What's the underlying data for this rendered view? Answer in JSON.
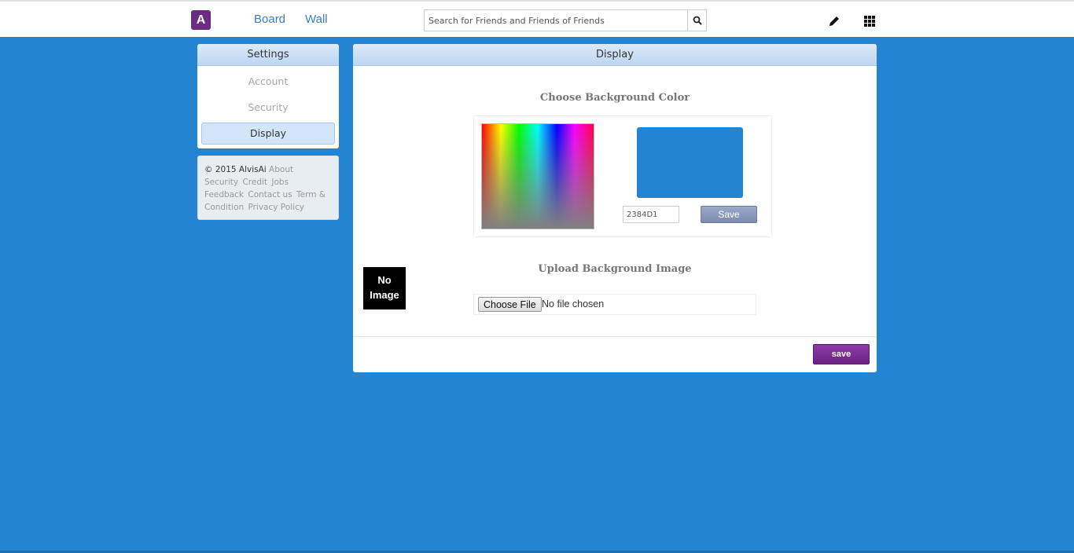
{
  "header": {
    "logo_letter": "A",
    "nav": [
      {
        "label": "Board"
      },
      {
        "label": "Wall"
      }
    ],
    "search": {
      "placeholder": "Search for Friends and Friends of Friends",
      "value": ""
    },
    "icons": [
      "search-icon",
      "pencil-icon",
      "apps-grid-icon"
    ]
  },
  "sidebar": {
    "title": "Settings",
    "items": [
      {
        "label": "Account",
        "active": false
      },
      {
        "label": "Security",
        "active": false
      },
      {
        "label": "Display",
        "active": true
      }
    ]
  },
  "footer": {
    "copyright": "© 2015 AlvisAi",
    "links": [
      "About",
      "Security",
      "Credit",
      "Jobs",
      "Feedback",
      "Contact us",
      "Term & Condition",
      "Privacy Policy"
    ]
  },
  "display": {
    "title": "Display",
    "color_section_title": "Choose Background Color",
    "hex_value": "2384D1",
    "color_save_label": "Save",
    "upload_section_title": "Upload Background Image",
    "no_image_label": "No Image",
    "choose_file_label": "Choose File",
    "file_status": "No file chosen",
    "save_label": "save"
  },
  "colors": {
    "page_background": "#2384D1",
    "brand_purple": "#6b2d84",
    "selected_color": "#2384D1"
  }
}
